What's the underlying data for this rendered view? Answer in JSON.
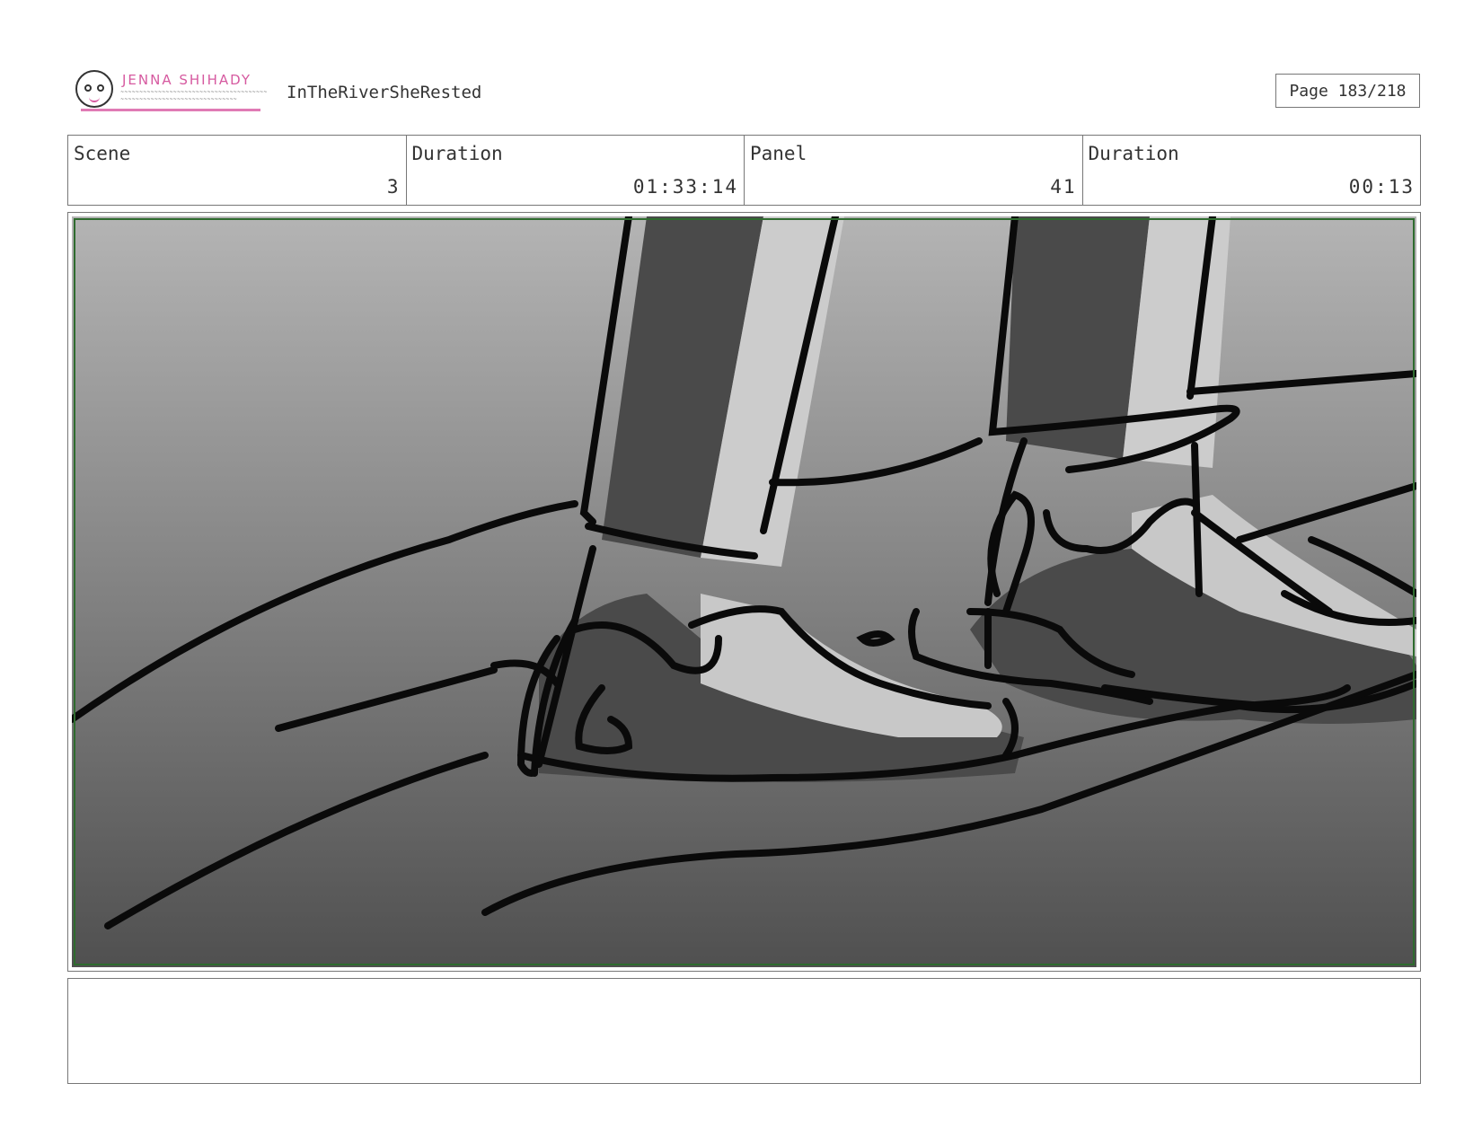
{
  "header": {
    "logo_name": "JENNA SHIHADY",
    "project_title": "InTheRiverSheRested",
    "page_label": "Page 183/218"
  },
  "info": [
    {
      "label": "Scene",
      "value": "3"
    },
    {
      "label": "Duration",
      "value": "01:33:14"
    },
    {
      "label": "Panel",
      "value": "41"
    },
    {
      "label": "Duration",
      "value": "00:13"
    }
  ],
  "colors": {
    "logo_accent": "#d65aa0",
    "safe_frame": "#2e6b2e"
  }
}
